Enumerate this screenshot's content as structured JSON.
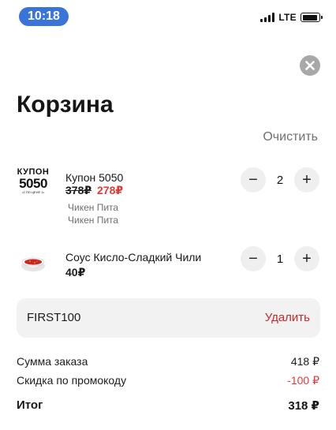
{
  "status_bar": {
    "time": "10:18",
    "network": "LTE"
  },
  "header": {
    "title": "Корзина",
    "clear_label": "Очистить"
  },
  "icons": {
    "close": "close-icon",
    "minus": "minus-icon",
    "plus": "plus-icon"
  },
  "items": [
    {
      "image_text": [
        "КУПОН",
        "5050",
        "•2 ПО ЦЕНЕ 1•"
      ],
      "name": "Купон 5050",
      "old_price": "378₽",
      "price": "278₽",
      "options": [
        "Чикен Пита",
        "Чикен Пита"
      ],
      "quantity": "2",
      "minus": "−",
      "plus": "+"
    },
    {
      "image": "sauce-image",
      "name": "Соус Кисло-Сладкий Чили",
      "price": "40₽",
      "quantity": "1",
      "minus": "−",
      "plus": "+"
    }
  ],
  "promo": {
    "code": "FIRST100",
    "remove_label": "Удалить"
  },
  "summary": {
    "order_label": "Сумма заказа",
    "order_value": "418 ₽",
    "discount_label": "Скидка по промокоду",
    "discount_value": "-100 ₽",
    "total_label": "Итог",
    "total_value": "318 ₽"
  },
  "colors": {
    "accent_red": "#e53935",
    "remove_red": "#c62828",
    "time_pill": "#3b74d8"
  }
}
